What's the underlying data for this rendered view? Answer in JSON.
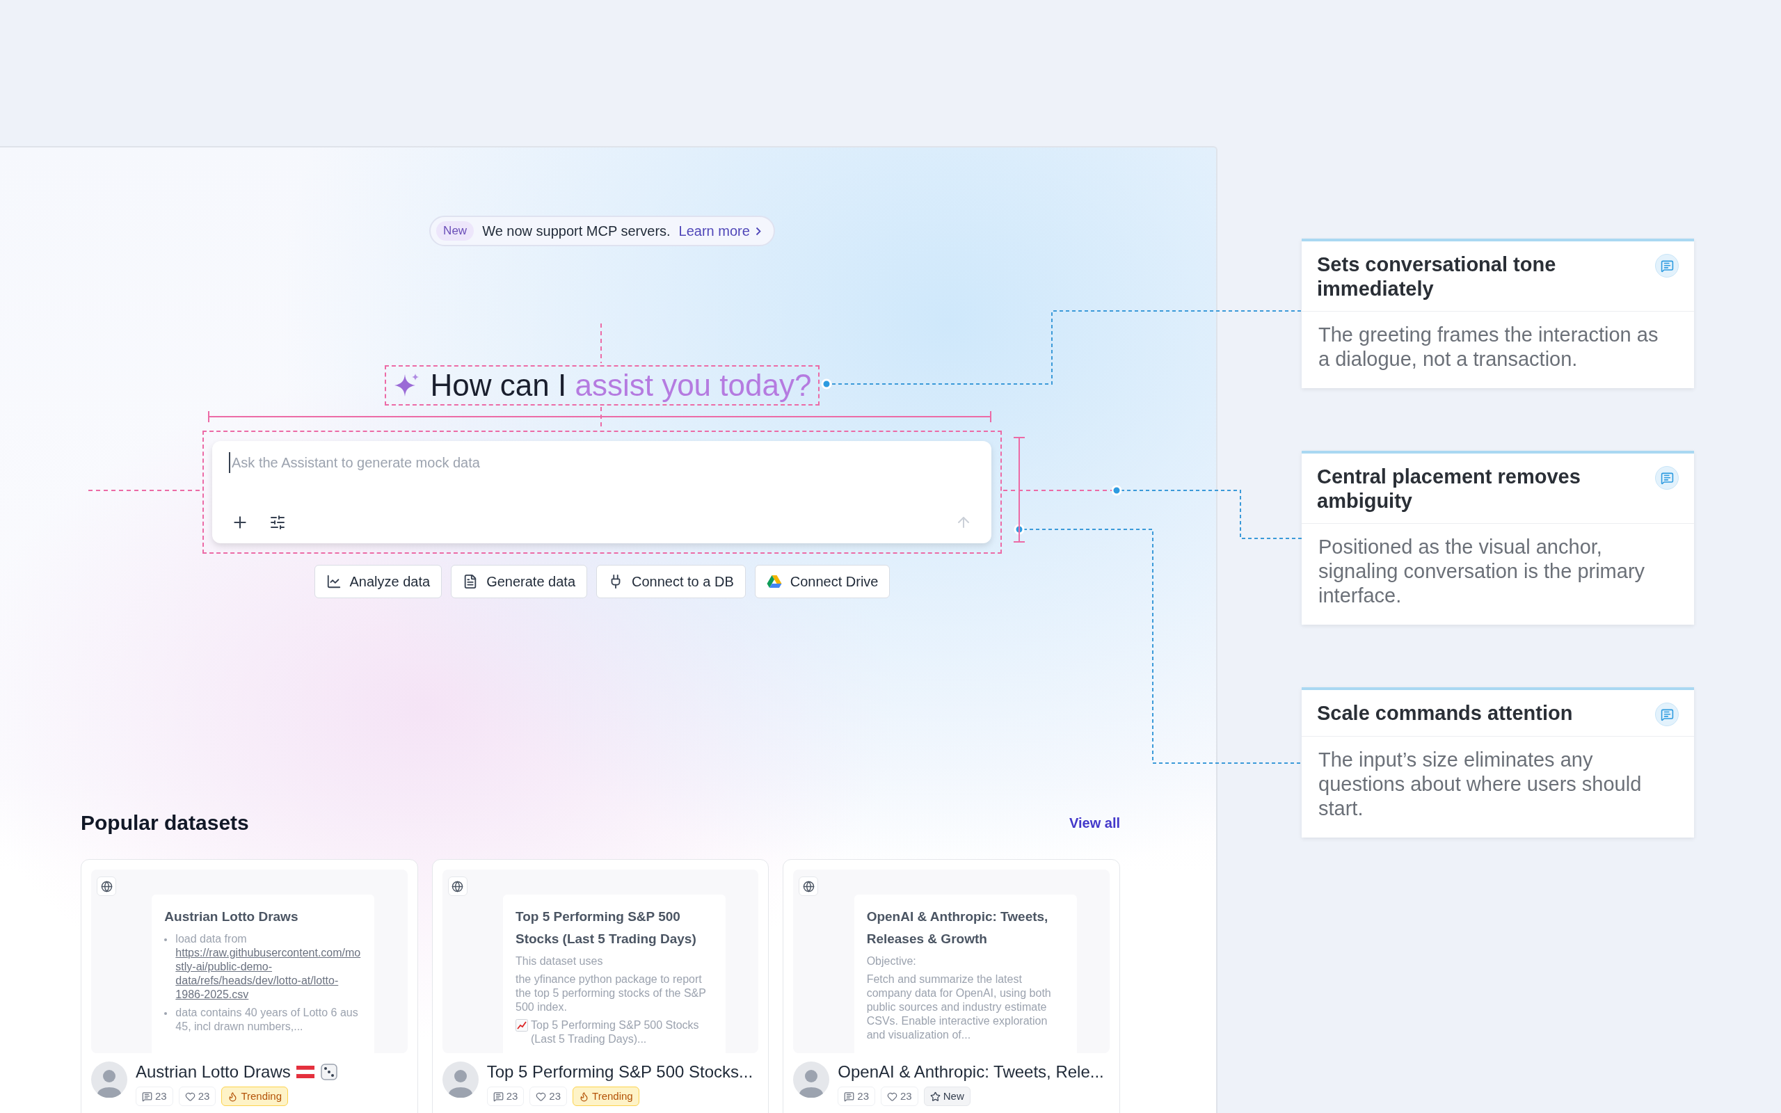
{
  "banner": {
    "badge": "New",
    "text": "We now support MCP servers.",
    "link": "Learn more"
  },
  "heading": {
    "text": "How can I",
    "accent": "assist you today?"
  },
  "prompt": {
    "placeholder": "Ask the Assistant to generate mock data"
  },
  "suggestions": [
    {
      "kind": "analyze",
      "label": "Analyze data"
    },
    {
      "kind": "generate",
      "label": "Generate data"
    },
    {
      "kind": "database",
      "label": "Connect to a DB"
    },
    {
      "kind": "drive",
      "label": "Connect Drive"
    }
  ],
  "datasets": {
    "title": "Popular datasets",
    "view_all": "View all",
    "cards": [
      {
        "preview_title": "Austrian Lotto Draws",
        "preview": [
          {
            "kind": "bullet",
            "text": "load data from",
            "link": "https://raw.githubusercontent.com/mostly-ai/public-demo-data/refs/heads/dev/lotto-at/lotto-1986-2025.csv"
          },
          {
            "kind": "bullet",
            "text": "data contains 40 years of Lotto 6 aus 45, incl drawn numbers,..."
          }
        ],
        "title": "Austrian Lotto Draws",
        "has_flag": true,
        "has_dice": true,
        "comments": "23",
        "likes": "23",
        "badge": {
          "kind": "trending",
          "label": "Trending"
        }
      },
      {
        "preview_title": "Top 5 Performing S&P 500 Stocks (Last 5 Trading Days)",
        "preview": [
          {
            "kind": "text",
            "text": "This dataset uses"
          },
          {
            "kind": "text",
            "text": "the yfinance python package to report the top 5 performing stocks of the S&P 500 index."
          },
          {
            "kind": "chart_text",
            "text": "Top 5 Performing S&P 500 Stocks (Last 5 Trading Days)..."
          }
        ],
        "title": "Top 5 Performing S&P 500 Stocks...",
        "comments": "23",
        "likes": "23",
        "badge": {
          "kind": "trending",
          "label": "Trending"
        }
      },
      {
        "preview_title": "OpenAI & Anthropic: Tweets, Releases & Growth",
        "preview": [
          {
            "kind": "text",
            "text": "Objective:"
          },
          {
            "kind": "text",
            "text": "Fetch and summarize the latest company data for OpenAI, using both public sources and industry estimate CSVs. Enable interactive exploration and visualization of..."
          }
        ],
        "title": "OpenAI & Anthropic: Tweets, Rele...",
        "comments": "23",
        "likes": "23",
        "badge": {
          "kind": "new",
          "label": "New"
        }
      }
    ]
  },
  "annotations": [
    {
      "title": "Sets conversational tone immediately",
      "body": "The greeting frames the interaction as a dialogue, not a transaction."
    },
    {
      "title": "Central placement removes ambiguity",
      "body": "Positioned as the visual anchor, signaling conversation is the primary interface."
    },
    {
      "title": "Scale commands attention",
      "body": "The input’s size eliminates any questions about where users should start."
    }
  ]
}
